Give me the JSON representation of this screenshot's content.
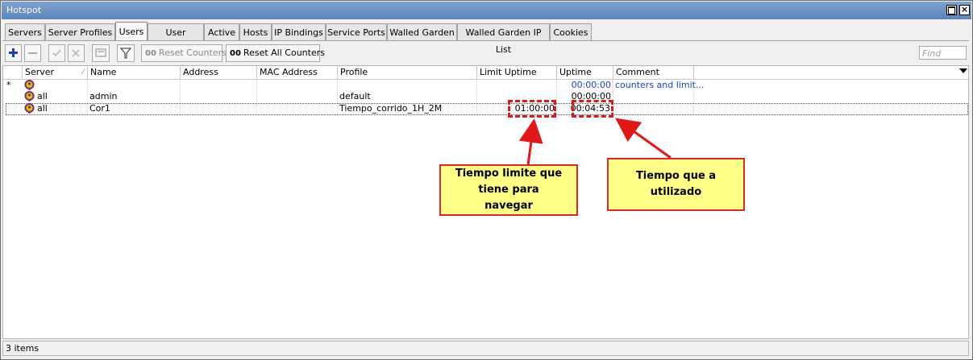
{
  "window": {
    "title": "Hotspot"
  },
  "tabs": [
    "Servers",
    "Server Profiles",
    "Users",
    "User Profiles",
    "Active",
    "Hosts",
    "IP Bindings",
    "Service Ports",
    "Walled Garden",
    "Walled Garden IP List",
    "Cookies"
  ],
  "active_tab": "Users",
  "toolbar": {
    "reset_counters": "Reset Counters",
    "reset_all_counters": "Reset All Counters",
    "counter_prefix": "00",
    "find_placeholder": "Find"
  },
  "columns": [
    "Server",
    "Name",
    "Address",
    "MAC Address",
    "Profile",
    "Limit Uptime",
    "Uptime",
    "Comment"
  ],
  "rows": [
    {
      "flag": "*",
      "server": "",
      "name": "",
      "address": "",
      "mac": "",
      "profile": "",
      "limit_uptime": "",
      "uptime": "00:00:00",
      "comment": "counters and limit..."
    },
    {
      "flag": "",
      "server": "all",
      "name": "admin",
      "address": "",
      "mac": "",
      "profile": "default",
      "limit_uptime": "",
      "uptime": "00:00:00",
      "comment": ""
    },
    {
      "flag": "",
      "server": "all",
      "name": "Cor1",
      "address": "",
      "mac": "",
      "profile": "Tiempo_corrido_1H_2M",
      "limit_uptime": "01:00:00",
      "uptime": "00:04:53",
      "comment": ""
    }
  ],
  "status": {
    "items": "3 items"
  },
  "annotations": {
    "limit_note": "Tiempo limite que tiene para navegar",
    "uptime_note": "Tiempo que a utilizado"
  },
  "colors": {
    "titlebar": "#5b84bb",
    "annotation_fill": "#ffff88",
    "annotation_border": "#d42a2a",
    "link_blue": "#1a3fc4"
  }
}
